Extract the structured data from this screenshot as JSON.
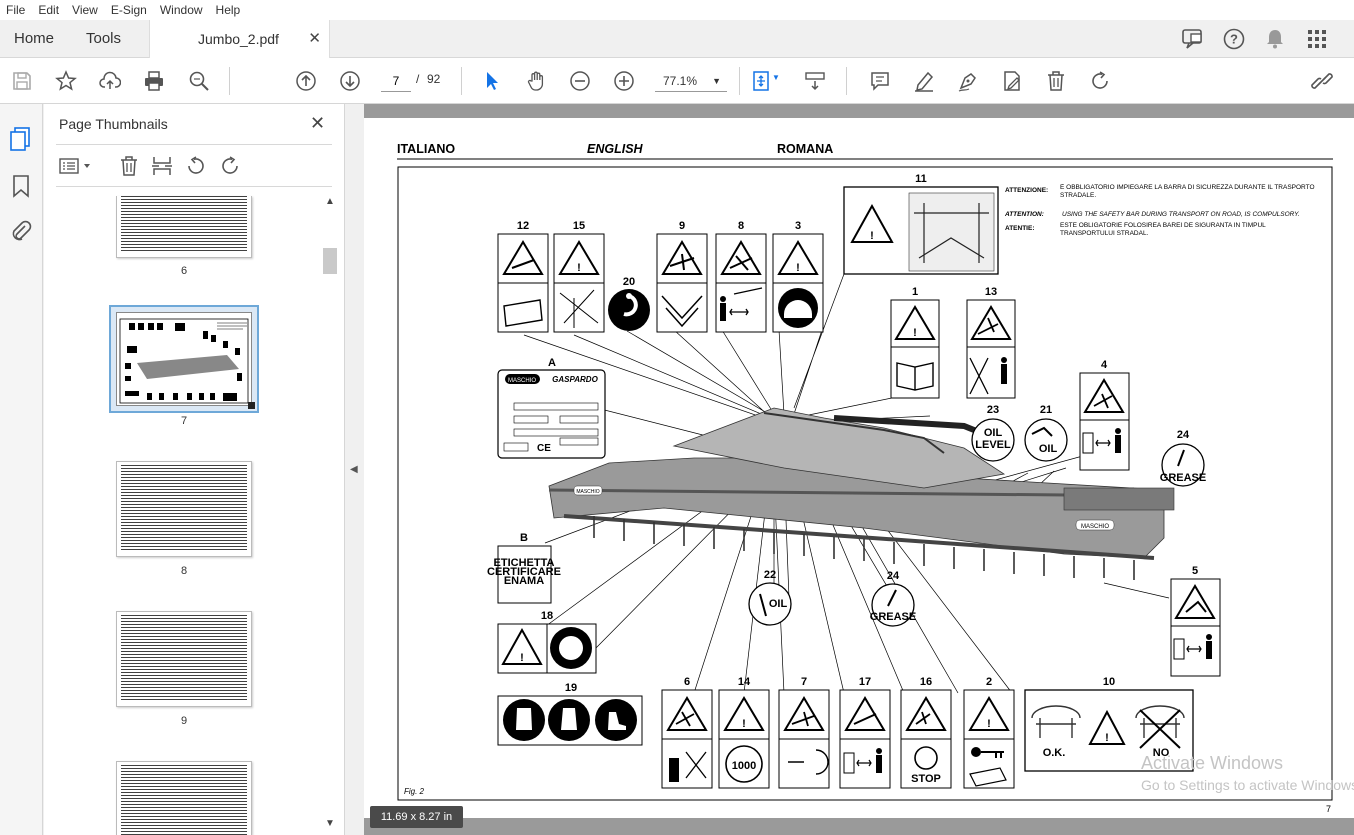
{
  "menu": [
    "File",
    "Edit",
    "View",
    "E-Sign",
    "Window",
    "Help"
  ],
  "tabs": {
    "home": "Home",
    "tools": "Tools",
    "document": "Jumbo_2.pdf",
    "close": "✕"
  },
  "toolbar": {
    "current_page": "7",
    "page_separator": "/",
    "total_pages": "92",
    "zoom": "77.1%"
  },
  "thumbnails_panel": {
    "title": "Page Thumbnails",
    "close": "✕",
    "thumbnails": [
      {
        "label": "6"
      },
      {
        "label": "7",
        "selected": true
      },
      {
        "label": "8"
      },
      {
        "label": "9"
      }
    ]
  },
  "document": {
    "headers": [
      "ITALIANO",
      "ENGLISH",
      "ROMANA"
    ],
    "warnings": [
      {
        "label": "ATTENZIONE:",
        "text": "È OBBLIGATORIO IMPIEGARE LA BARRA DI SICUREZZA DURANTE IL TRASPORTO STRADALE."
      },
      {
        "label": "ATTENTION:",
        "text": "USING THE SAFETY BAR DURING TRANSPORT ON ROAD, IS COMPULSORY."
      },
      {
        "label": "ATENTIE:",
        "text": "ESTE OBLIGATORIE FOLOSIREA BAREI DE SIGURANTA IN TIMPUL TRANSPORTULUI STRADAL."
      }
    ],
    "decal_numbers": {
      "n11": "11",
      "n12": "12",
      "n15": "15",
      "n9": "9",
      "n8": "8",
      "n3": "3",
      "n20": "20",
      "n1": "1",
      "n13": "13",
      "n4": "4",
      "n23": "23",
      "n21": "21",
      "n24a": "24",
      "nA": "A",
      "nB": "B",
      "n18": "18",
      "n22": "22",
      "n24b": "24",
      "n5": "5",
      "n19": "19",
      "n6": "6",
      "n14": "14",
      "n7": "7",
      "n17": "17",
      "n16": "16",
      "n2": "2",
      "n10": "10"
    },
    "decal_texts": {
      "oil": "OIL",
      "level": "LEVEL",
      "grease": "GREASE",
      "etichetta1": "ETICHETTA",
      "etichetta2": "CERTIFICARE",
      "etichetta3": "ENAMA",
      "maschio": "MASCHIO",
      "gaspardo": "GASPARDO",
      "ce": "CE",
      "stop": "STOP",
      "n1000": "1000",
      "ok": "O.K.",
      "no": "NO"
    },
    "figure_caption": "Fig. 2",
    "page_number": "7"
  },
  "status": {
    "page_size": "11.69 x 8.27 in"
  },
  "watermark": {
    "line1": "Activate Windows",
    "line2": "Go to Settings to activate Windows."
  },
  "colors": {
    "accent": "#1473e6",
    "selected_border": "#6ea8d8",
    "viewer_bg": "#9a9a9a"
  }
}
